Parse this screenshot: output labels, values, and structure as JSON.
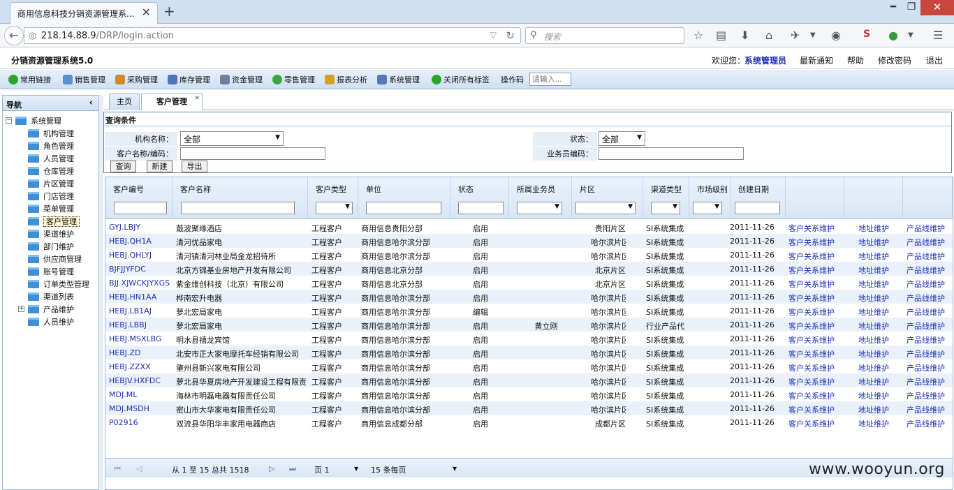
{
  "browser": {
    "tab_title": "商用信息科技分销资源管理系...",
    "url_host": "218.14.88.9",
    "url_path": "/DRP/login.action",
    "search_placeholder": "搜索"
  },
  "app": {
    "title": "分销资源管理系统5.0",
    "welcome_label": "欢迎您：",
    "user_name": "系统管理员",
    "links": [
      "最新通知",
      "帮助",
      "修改密码",
      "退出"
    ]
  },
  "menu": {
    "items": [
      {
        "label": "常用链接",
        "icon": "green-check-icon",
        "color": "#2aa52a"
      },
      {
        "label": "销售管理",
        "icon": "document-icon",
        "color": "#5a8fd0"
      },
      {
        "label": "采购管理",
        "icon": "edit-icon",
        "color": "#d08a2a"
      },
      {
        "label": "库存管理",
        "icon": "chart-icon",
        "color": "#4a76b8"
      },
      {
        "label": "资金管理",
        "icon": "ledger-icon",
        "color": "#6e7fa0"
      },
      {
        "label": "零售管理",
        "icon": "plus-circle-icon",
        "color": "#3aa83a"
      },
      {
        "label": "报表分析",
        "icon": "report-icon",
        "color": "#d8a020"
      },
      {
        "label": "系统管理",
        "icon": "monitor-icon",
        "color": "#5a78b0"
      },
      {
        "label": "关闭所有标签",
        "icon": "green-check-icon",
        "color": "#2aa52a"
      }
    ],
    "op_label": "操作码",
    "op_placeholder": "请输入..."
  },
  "nav": {
    "title": "导航",
    "root": "系统管理",
    "items": [
      "机构管理",
      "角色管理",
      "人员管理",
      "仓库管理",
      "片区管理",
      "门店管理",
      "菜单管理",
      "客户管理",
      "渠道维护",
      "部门维护",
      "供应商管理",
      "账号管理",
      "订单类型管理",
      "渠道列表",
      "产品维护",
      "人员维护"
    ],
    "selected_index": 7
  },
  "tabs": [
    {
      "label": "主页",
      "active": false
    },
    {
      "label": "客户管理",
      "active": true
    }
  ],
  "query": {
    "title": "查询条件",
    "org_label": "机构名称：",
    "org_value": "全部",
    "status_label": "状态：",
    "status_value": "全部",
    "cust_label": "客户名称/编码：",
    "cust_value": "",
    "sales_label": "业务员编码：",
    "sales_value": "",
    "buttons": [
      "查询",
      "新建",
      "导出"
    ]
  },
  "grid": {
    "columns": [
      "客户编号",
      "客户名称",
      "客户类型",
      "单位",
      "状态",
      "所属业务员",
      "片区",
      "渠道类型",
      "市场级别",
      "创建日期"
    ],
    "action_labels": [
      "客户关系维护",
      "地址维护",
      "产品线维护"
    ],
    "rows": [
      [
        "GYJ.LBJY",
        "蕺波聚缘酒店",
        "工程客户",
        "商用信息贵阳分部",
        "启用",
        "",
        "贵阳片区",
        "SI系统集成",
        "",
        "2011-11-26"
      ],
      [
        "HEBJ.QH1A",
        "清河优品家电",
        "工程客户",
        "商用信息哈尔滨分部",
        "启用",
        "",
        "哈尔滨片区",
        "SI系统集成",
        "",
        "2011-11-26"
      ],
      [
        "HEBJ.QHLYJ",
        "清河镇清河林业局金龙招待所",
        "工程客户",
        "商用信息哈尔滨分部",
        "启用",
        "",
        "哈尔滨片区",
        "SI系统集成",
        "",
        "2011-11-26"
      ],
      [
        "BJFJJYFDC",
        "北京方锦基业房地产开发有限公司",
        "工程客户",
        "商用信息北京分部",
        "启用",
        "",
        "北京片区",
        "SI系统集成",
        "",
        "2011-11-26"
      ],
      [
        "BJJ.XJWCKJYXGS",
        "紫金维创科技（北京）有限公司",
        "工程客户",
        "商用信息北京分部",
        "启用",
        "",
        "北京片区",
        "SI系统集成",
        "",
        "2011-11-26"
      ],
      [
        "HEBJ.HN1AA",
        "桦南宏升电器",
        "工程客户",
        "商用信息哈尔滨分部",
        "启用",
        "",
        "哈尔滨片区",
        "SI系统集成",
        "",
        "2011-11-26"
      ],
      [
        "HEBJ.LB1AJ",
        "萝北宏局家电",
        "工程客户",
        "商用信息哈尔滨分部",
        "编辑",
        "",
        "哈尔滨片区",
        "SI系统集成",
        "",
        "2011-11-26"
      ],
      [
        "HEBJ.LBBJ",
        "萝北宏局家电",
        "工程客户",
        "商用信息哈尔滨分部",
        "启用",
        "黄立刚",
        "哈尔滨片区",
        "行业产品代",
        "",
        "2011-11-26"
      ],
      [
        "HEBJ.MSXLBG",
        "明水县禧龙宾馆",
        "工程客户",
        "商用信息哈尔滨分部",
        "启用",
        "",
        "哈尔滨片区",
        "SI系统集成",
        "",
        "2011-11-26"
      ],
      [
        "HEBJ.ZD",
        "北安市正大家电摩托车经销有限公司",
        "工程客户",
        "商用信息哈尔滨分部",
        "启用",
        "",
        "哈尔滨片区",
        "SI系统集成",
        "",
        "2011-11-26"
      ],
      [
        "HEBJ.ZZXX",
        "肇州县新兴家电有限公司",
        "工程客户",
        "商用信息哈尔滨分部",
        "启用",
        "",
        "哈尔滨片区",
        "SI系统集成",
        "",
        "2011-11-26"
      ],
      [
        "HEBJV.HXFDC",
        "萝北县华夏房地产开发建设工程有限责",
        "工程客户",
        "商用信息哈尔滨分部",
        "启用",
        "",
        "哈尔滨片区",
        "SI系统集成",
        "",
        "2011-11-26"
      ],
      [
        "MDJ.ML",
        "海林市明磊电器有限责任公司",
        "工程客户",
        "商用信息哈尔滨分部",
        "启用",
        "",
        "哈尔滨片区",
        "SI系统集成",
        "",
        "2011-11-26"
      ],
      [
        "MDJ.MSDH",
        "密山市大华家电有限责任公司",
        "工程客户",
        "商用信息哈尔滨分部",
        "启用",
        "",
        "哈尔滨片区",
        "SI系统集成",
        "",
        "2011-11-26"
      ],
      [
        "P02916",
        "双流县华阳华丰家用电器商店",
        "工程客户",
        "商用信息成都分部",
        "启用",
        "",
        "成都片区",
        "SI系统集成",
        "",
        "2011-11-26"
      ]
    ]
  },
  "pager": {
    "range_text": "从 1 至 15 总共 1518",
    "page_text": "页 1",
    "per_page_text": "15 条每页"
  },
  "watermark": "www.wooyun.org"
}
